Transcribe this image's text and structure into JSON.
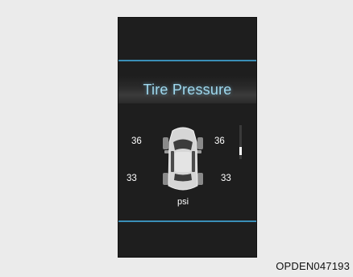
{
  "display": {
    "title": "Tire Pressure",
    "unit": "psi",
    "tires": {
      "front_left": "36",
      "front_right": "36",
      "rear_left": "33",
      "rear_right": "33"
    },
    "accent_color": "#3a8fb7",
    "title_color": "#9fd8ee",
    "car_icon": "car-top-view-icon"
  },
  "figure_code": "OPDEN047193"
}
